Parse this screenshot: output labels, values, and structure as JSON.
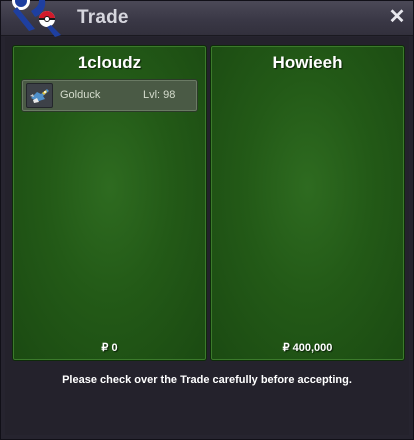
{
  "window": {
    "title": "Trade",
    "close_label": "✕"
  },
  "left_panel": {
    "trader_name": "1cloudz",
    "items": [
      {
        "name": "Golduck",
        "level": "Lvl: 98",
        "icon": "golduck-sprite-icon"
      }
    ],
    "money": "₽ 0"
  },
  "right_panel": {
    "trader_name": "Howieeh",
    "items": [],
    "money": "₽ 400,000"
  },
  "footer": {
    "message": "Please check over the Trade carefully before accepting."
  },
  "colors": {
    "panel_green": "#235a17",
    "window_bg": "#26242f",
    "title_text": "#d6d6de"
  }
}
